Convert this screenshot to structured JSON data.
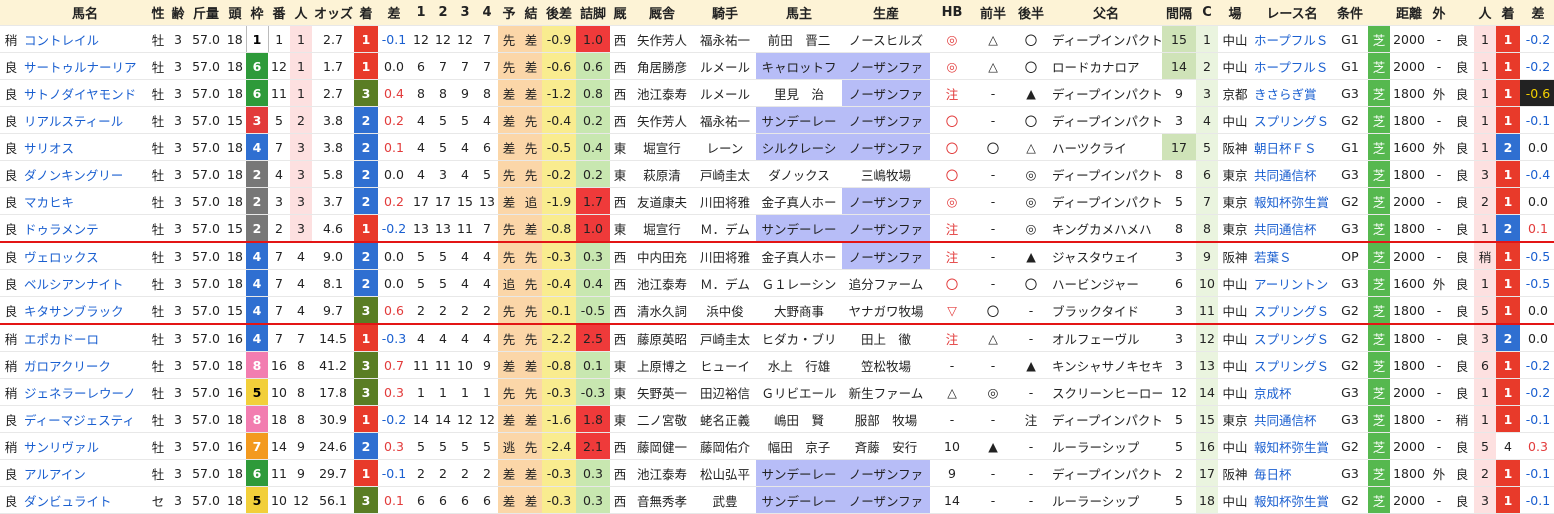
{
  "headers": [
    "",
    "馬名",
    "性",
    "齢",
    "斤量",
    "頭",
    "枠",
    "番",
    "人",
    "オッズ",
    "着",
    "差",
    "1",
    "2",
    "3",
    "4",
    "予",
    "結",
    "後差",
    "詰脚",
    "厩",
    "厩舎",
    "騎手",
    "馬主",
    "生産",
    "HB",
    "前半",
    "後半",
    "父名",
    "間隔",
    "C",
    "場",
    "レース名",
    "条件",
    "",
    "距離",
    "外",
    "",
    "人",
    "着",
    "差"
  ],
  "rows": [
    [
      "稍",
      "コントレイル",
      "牡",
      "3",
      "57.0",
      "18",
      "1",
      "1",
      "1",
      "2.7",
      "1",
      "-0.1",
      "12",
      "12",
      "12",
      "7",
      "先",
      "差",
      "-0.9",
      "1.0",
      "西",
      "矢作芳人",
      "福永祐一",
      "前田　晋二",
      "ノースヒルズ",
      "◎",
      "△",
      "〇",
      "ディープインパクト",
      "15",
      "1",
      "中山",
      "ホープフルＳ",
      "G1",
      "芝",
      "2000",
      "-",
      "良",
      "1",
      "1",
      "-0.2"
    ],
    [
      "良",
      "サートゥルナーリア",
      "牡",
      "3",
      "57.0",
      "18",
      "6",
      "12",
      "1",
      "1.7",
      "1",
      "0.0",
      "6",
      "7",
      "7",
      "7",
      "先",
      "差",
      "-0.6",
      "0.6",
      "西",
      "角居勝彦",
      "ルメール",
      "キャロットフ",
      "ノーザンファ",
      "◎",
      "△",
      "〇",
      "ロードカナロア",
      "14",
      "2",
      "中山",
      "ホープフルＳ",
      "G1",
      "芝",
      "2000",
      "-",
      "良",
      "1",
      "1",
      "-0.2"
    ],
    [
      "良",
      "サトノダイヤモンド",
      "牡",
      "3",
      "57.0",
      "18",
      "6",
      "11",
      "1",
      "2.7",
      "3",
      "0.4",
      "8",
      "8",
      "9",
      "8",
      "差",
      "差",
      "-1.2",
      "0.8",
      "西",
      "池江泰寿",
      "ルメール",
      "里見　治",
      "ノーザンファ",
      "注",
      "-",
      "▲",
      "ディープインパクト",
      "9",
      "3",
      "京都",
      "きさらぎ賞",
      "G3",
      "芝",
      "1800",
      "外",
      "良",
      "1",
      "1",
      "-0.6"
    ],
    [
      "良",
      "リアルスティール",
      "牡",
      "3",
      "57.0",
      "15",
      "3",
      "5",
      "2",
      "3.8",
      "2",
      "0.2",
      "4",
      "5",
      "5",
      "4",
      "差",
      "先",
      "-0.4",
      "0.2",
      "西",
      "矢作芳人",
      "福永祐一",
      "サンデーレー",
      "ノーザンファ",
      "〇",
      "-",
      "〇",
      "ディープインパクト",
      "3",
      "4",
      "中山",
      "スプリングＳ",
      "G2",
      "芝",
      "1800",
      "-",
      "良",
      "1",
      "1",
      "-0.1"
    ],
    [
      "良",
      "サリオス",
      "牡",
      "3",
      "57.0",
      "18",
      "4",
      "7",
      "3",
      "3.8",
      "2",
      "0.1",
      "4",
      "5",
      "4",
      "6",
      "差",
      "先",
      "-0.5",
      "0.4",
      "東",
      "堀宣行",
      "レーン",
      "シルクレーシ",
      "ノーザンファ",
      "〇",
      "〇",
      "△",
      "ハーツクライ",
      "17",
      "5",
      "阪神",
      "朝日杯ＦＳ",
      "G1",
      "芝",
      "1600",
      "外",
      "良",
      "1",
      "2",
      "0.0"
    ],
    [
      "良",
      "ダノンキングリー",
      "牡",
      "3",
      "57.0",
      "18",
      "2",
      "4",
      "3",
      "5.8",
      "2",
      "0.0",
      "4",
      "3",
      "4",
      "5",
      "先",
      "先",
      "-0.2",
      "0.2",
      "東",
      "萩原清",
      "戸崎圭太",
      "ダノックス",
      "三嶋牧場",
      "〇",
      "-",
      "◎",
      "ディープインパクト",
      "8",
      "6",
      "東京",
      "共同通信杯",
      "G3",
      "芝",
      "1800",
      "-",
      "良",
      "3",
      "1",
      "-0.4"
    ],
    [
      "良",
      "マカヒキ",
      "牡",
      "3",
      "57.0",
      "18",
      "2",
      "3",
      "3",
      "3.7",
      "2",
      "0.2",
      "17",
      "17",
      "15",
      "13",
      "差",
      "追",
      "-1.9",
      "1.7",
      "西",
      "友道康夫",
      "川田将雅",
      "金子真人ホー",
      "ノーザンファ",
      "◎",
      "-",
      "◎",
      "ディープインパクト",
      "5",
      "7",
      "東京",
      "報知杯弥生賞",
      "G2",
      "芝",
      "2000",
      "-",
      "良",
      "2",
      "1",
      "0.0"
    ],
    [
      "良",
      "ドゥラメンテ",
      "牡",
      "3",
      "57.0",
      "15",
      "2",
      "2",
      "3",
      "4.6",
      "1",
      "-0.2",
      "13",
      "13",
      "11",
      "7",
      "先",
      "差",
      "-0.8",
      "1.0",
      "東",
      "堀宣行",
      "Ｍ．デム",
      "サンデーレー",
      "ノーザンファ",
      "注",
      "-",
      "◎",
      "キングカメハメハ",
      "8",
      "8",
      "東京",
      "共同通信杯",
      "G3",
      "芝",
      "1800",
      "-",
      "良",
      "1",
      "2",
      "0.1"
    ],
    [
      "良",
      "ヴェロックス",
      "牡",
      "3",
      "57.0",
      "18",
      "4",
      "7",
      "4",
      "9.0",
      "2",
      "0.0",
      "5",
      "5",
      "4",
      "4",
      "先",
      "先",
      "-0.3",
      "0.3",
      "西",
      "中内田充",
      "川田将雅",
      "金子真人ホー",
      "ノーザンファ",
      "注",
      "-",
      "▲",
      "ジャスタウェイ",
      "3",
      "9",
      "阪神",
      "若葉Ｓ",
      "OP",
      "芝",
      "2000",
      "-",
      "良",
      "稍",
      "1",
      "-0.5"
    ],
    [
      "良",
      "ベルシアンナイト",
      "牡",
      "3",
      "57.0",
      "18",
      "4",
      "7",
      "4",
      "8.1",
      "2",
      "0.0",
      "5",
      "5",
      "4",
      "4",
      "追",
      "先",
      "-0.4",
      "0.4",
      "西",
      "池江泰寿",
      "Ｍ．デム",
      "Ｇ１レーシン",
      "追分ファーム",
      "〇",
      "-",
      "〇",
      "ハービンジャー",
      "6",
      "10",
      "中山",
      "アーリントン",
      "G3",
      "芝",
      "1600",
      "外",
      "良",
      "1",
      "1",
      "-0.5"
    ],
    [
      "良",
      "キタサンブラック",
      "牡",
      "3",
      "57.0",
      "15",
      "4",
      "7",
      "4",
      "9.7",
      "3",
      "0.6",
      "2",
      "2",
      "2",
      "2",
      "先",
      "先",
      "-0.1",
      "-0.5",
      "西",
      "清水久詞",
      "浜中俊",
      "大野商事",
      "ヤナガワ牧場",
      "▽",
      "〇",
      "-",
      "ブラックタイド",
      "3",
      "11",
      "中山",
      "スプリングＳ",
      "G2",
      "芝",
      "1800",
      "-",
      "良",
      "5",
      "1",
      "0.0"
    ],
    [
      "稍",
      "エポカドーロ",
      "牡",
      "3",
      "57.0",
      "16",
      "4",
      "7",
      "7",
      "14.5",
      "1",
      "-0.3",
      "4",
      "4",
      "4",
      "4",
      "先",
      "先",
      "-2.2",
      "2.5",
      "西",
      "藤原英昭",
      "戸崎圭太",
      "ヒダカ・ブリ",
      "田上　徹",
      "注",
      "△",
      "-",
      "オルフェーヴル",
      "3",
      "12",
      "中山",
      "スプリングＳ",
      "G2",
      "芝",
      "1800",
      "-",
      "良",
      "3",
      "2",
      "0.0"
    ],
    [
      "稍",
      "ガロアクリーク",
      "牡",
      "3",
      "57.0",
      "18",
      "8",
      "16",
      "8",
      "41.2",
      "3",
      "0.7",
      "11",
      "11",
      "10",
      "9",
      "差",
      "差",
      "-0.8",
      "0.1",
      "東",
      "上原博之",
      "ヒューイ",
      "水上　行雄",
      "笠松牧場",
      "-",
      "-",
      "▲",
      "キンシャサノキセキ",
      "3",
      "13",
      "中山",
      "スプリングＳ",
      "G2",
      "芝",
      "1800",
      "-",
      "良",
      "6",
      "1",
      "-0.2"
    ],
    [
      "稍",
      "ジェネラーレウーノ",
      "牡",
      "3",
      "57.0",
      "16",
      "5",
      "10",
      "8",
      "17.8",
      "3",
      "0.3",
      "1",
      "1",
      "1",
      "1",
      "先",
      "先",
      "-0.3",
      "-0.3",
      "東",
      "矢野英一",
      "田辺裕信",
      "Ｇリビエール",
      "新生ファーム",
      "△",
      "◎",
      "-",
      "スクリーンヒーロー",
      "12",
      "14",
      "中山",
      "京成杯",
      "G3",
      "芝",
      "2000",
      "-",
      "良",
      "1",
      "1",
      "-0.2"
    ],
    [
      "良",
      "ディーマジェスティ",
      "牡",
      "3",
      "57.0",
      "18",
      "8",
      "18",
      "8",
      "30.9",
      "1",
      "-0.2",
      "14",
      "14",
      "12",
      "12",
      "差",
      "差",
      "-1.6",
      "1.8",
      "東",
      "二ノ宮敬",
      "蛯名正義",
      "嶋田　賢",
      "服部　牧場",
      "-",
      "-",
      "注",
      "ディープインパクト",
      "5",
      "15",
      "東京",
      "共同通信杯",
      "G3",
      "芝",
      "1800",
      "-",
      "稍",
      "1",
      "1",
      "-0.1"
    ],
    [
      "稍",
      "サンリヴァル",
      "牡",
      "3",
      "57.0",
      "16",
      "7",
      "14",
      "9",
      "24.6",
      "2",
      "0.3",
      "5",
      "5",
      "5",
      "5",
      "逃",
      "先",
      "-2.4",
      "2.1",
      "西",
      "藤岡健一",
      "藤岡佑介",
      "幅田　京子",
      "斉藤　安行",
      "10",
      "▲",
      "-",
      "ルーラーシップ",
      "5",
      "16",
      "中山",
      "報知杯弥生賞",
      "G2",
      "芝",
      "2000",
      "-",
      "良",
      "5",
      "4",
      "0.3"
    ],
    [
      "良",
      "アルアイン",
      "牡",
      "3",
      "57.0",
      "18",
      "6",
      "11",
      "9",
      "29.7",
      "1",
      "-0.1",
      "2",
      "2",
      "2",
      "2",
      "差",
      "差",
      "-0.3",
      "0.3",
      "西",
      "池江泰寿",
      "松山弘平",
      "サンデーレー",
      "ノーザンファ",
      "9",
      "-",
      "-",
      "ディープインパクト",
      "2",
      "17",
      "阪神",
      "毎日杯",
      "G3",
      "芝",
      "1800",
      "外",
      "良",
      "2",
      "1",
      "-0.1"
    ],
    [
      "良",
      "ダンビュライト",
      "セ",
      "3",
      "57.0",
      "18",
      "5",
      "10",
      "12",
      "56.1",
      "3",
      "0.1",
      "6",
      "6",
      "6",
      "6",
      "差",
      "差",
      "-0.3",
      "0.3",
      "西",
      "音無秀孝",
      "武豊",
      "サンデーレー",
      "ノーザンファ",
      "14",
      "-",
      "-",
      "ルーラーシップ",
      "5",
      "18",
      "中山",
      "報知杯弥生賞",
      "G2",
      "芝",
      "2000",
      "-",
      "良",
      "3",
      "1",
      "-0.1"
    ]
  ]
}
